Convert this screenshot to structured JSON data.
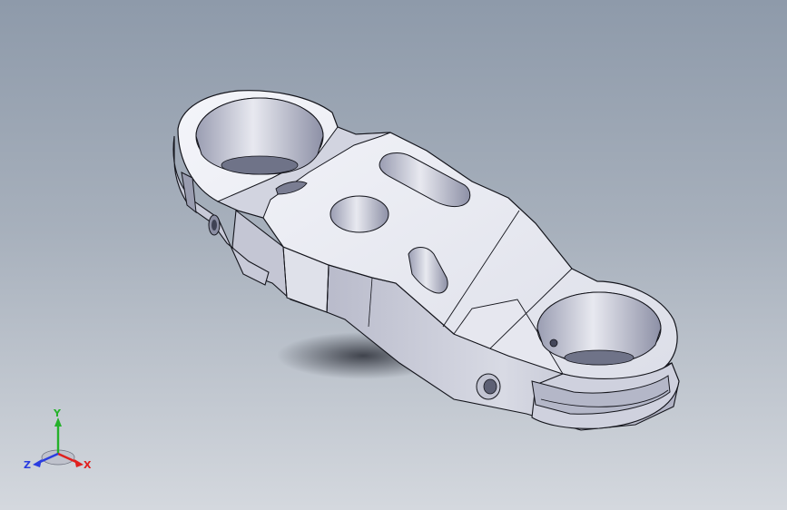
{
  "triad": {
    "x_label": "X",
    "y_label": "Y",
    "z_label": "Z",
    "x_color": "#e0201e",
    "y_color": "#25b12a",
    "z_color": "#2a3de0"
  },
  "colors": {
    "background_top": "#8e9aaa",
    "background_bottom": "#d4d8de",
    "part_light": "#eceef5",
    "part_mid": "#c9cbd8",
    "part_dark": "#9699ad",
    "edge": "#14151c"
  }
}
